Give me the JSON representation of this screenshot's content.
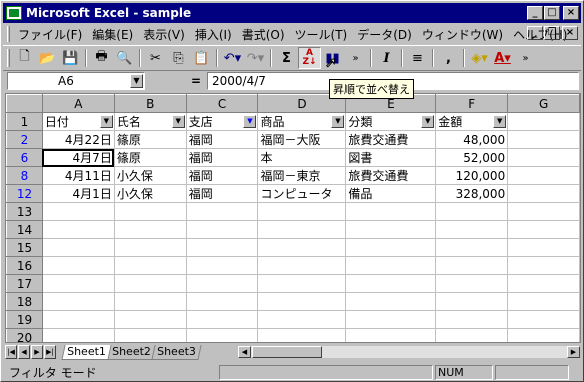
{
  "window": {
    "title": "Microsoft Excel - sample"
  },
  "menu": [
    "ファイル(F)",
    "編集(E)",
    "表示(V)",
    "挿入(I)",
    "書式(O)",
    "ツール(T)",
    "データ(D)",
    "ウィンドウ(W)",
    "ヘルプ(H)"
  ],
  "formula_bar": {
    "name_box": "A6",
    "equals": "=",
    "value": "2000/4/7"
  },
  "tooltip": "昇順で並べ替え",
  "columns": [
    "A",
    "B",
    "C",
    "D",
    "E",
    "F",
    "G"
  ],
  "header_row": {
    "row": "1",
    "cells": [
      "日付",
      "氏名",
      "支店",
      "商品",
      "分類",
      "金額"
    ]
  },
  "data_rows": [
    {
      "row": "2",
      "cells": [
        "4月22日",
        "篠原",
        "福岡",
        "福岡－大阪",
        "旅費交通費",
        "48,000"
      ]
    },
    {
      "row": "6",
      "cells": [
        "4月7日",
        "篠原",
        "福岡",
        "本",
        "図書",
        "52,000"
      ]
    },
    {
      "row": "8",
      "cells": [
        "4月11日",
        "小久保",
        "福岡",
        "福岡－東京",
        "旅費交通費",
        "120,000"
      ]
    },
    {
      "row": "12",
      "cells": [
        "4月1日",
        "小久保",
        "福岡",
        "コンピュータ",
        "備品",
        "328,000"
      ]
    }
  ],
  "empty_rows": [
    "13",
    "14",
    "15",
    "16",
    "17",
    "18",
    "19",
    "20"
  ],
  "sheet_tabs": [
    "Sheet1",
    "Sheet2",
    "Sheet3"
  ],
  "status": {
    "mode": "フィルタ モード",
    "num": "NUM"
  },
  "colors": {
    "title_bg": "#000080",
    "filtered_row_header": "#0000ff",
    "active_filter_arrow": "#0000ff"
  }
}
